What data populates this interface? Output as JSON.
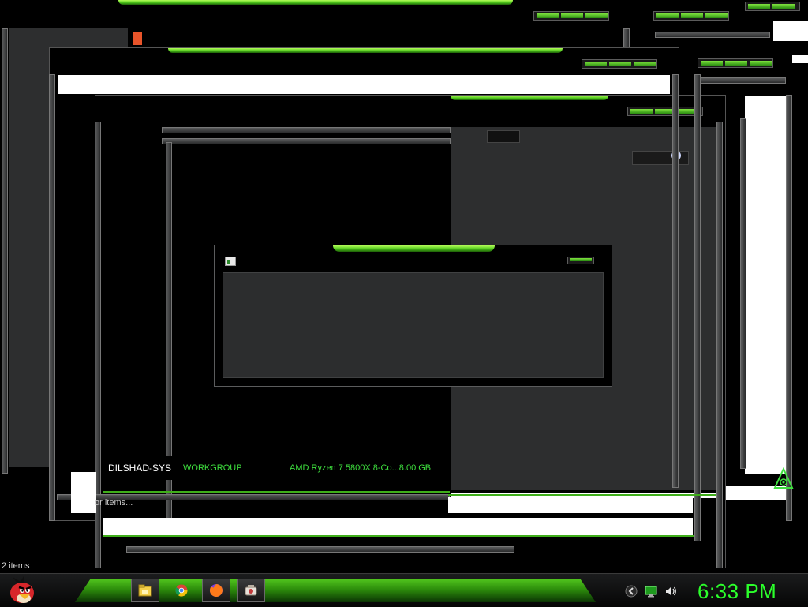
{
  "desktop": {
    "background": "#000000",
    "accent": "#3ee03e"
  },
  "dialog": {
    "title": "",
    "icon": "window-icon"
  },
  "system_info": {
    "computer_name": "DILSHAD-SYS",
    "workgroup": "WORKGROUP",
    "processor_memory": "AMD Ryzen 7 5800X 8-Co...8.00 GB"
  },
  "explorer": {
    "status_hint": "or items...",
    "item_count": "2 items"
  },
  "taskbar": {
    "start_icon": "angry-bird-start-icon",
    "pinned": [
      {
        "name": "file-explorer-icon",
        "active": true
      },
      {
        "name": "chrome-icon",
        "active": false
      },
      {
        "name": "firefox-icon",
        "active": true
      },
      {
        "name": "app-icon",
        "active": true
      }
    ],
    "tray": [
      "back-arrow-icon",
      "network-icon",
      "volume-icon"
    ],
    "clock": "6:33 PM"
  }
}
